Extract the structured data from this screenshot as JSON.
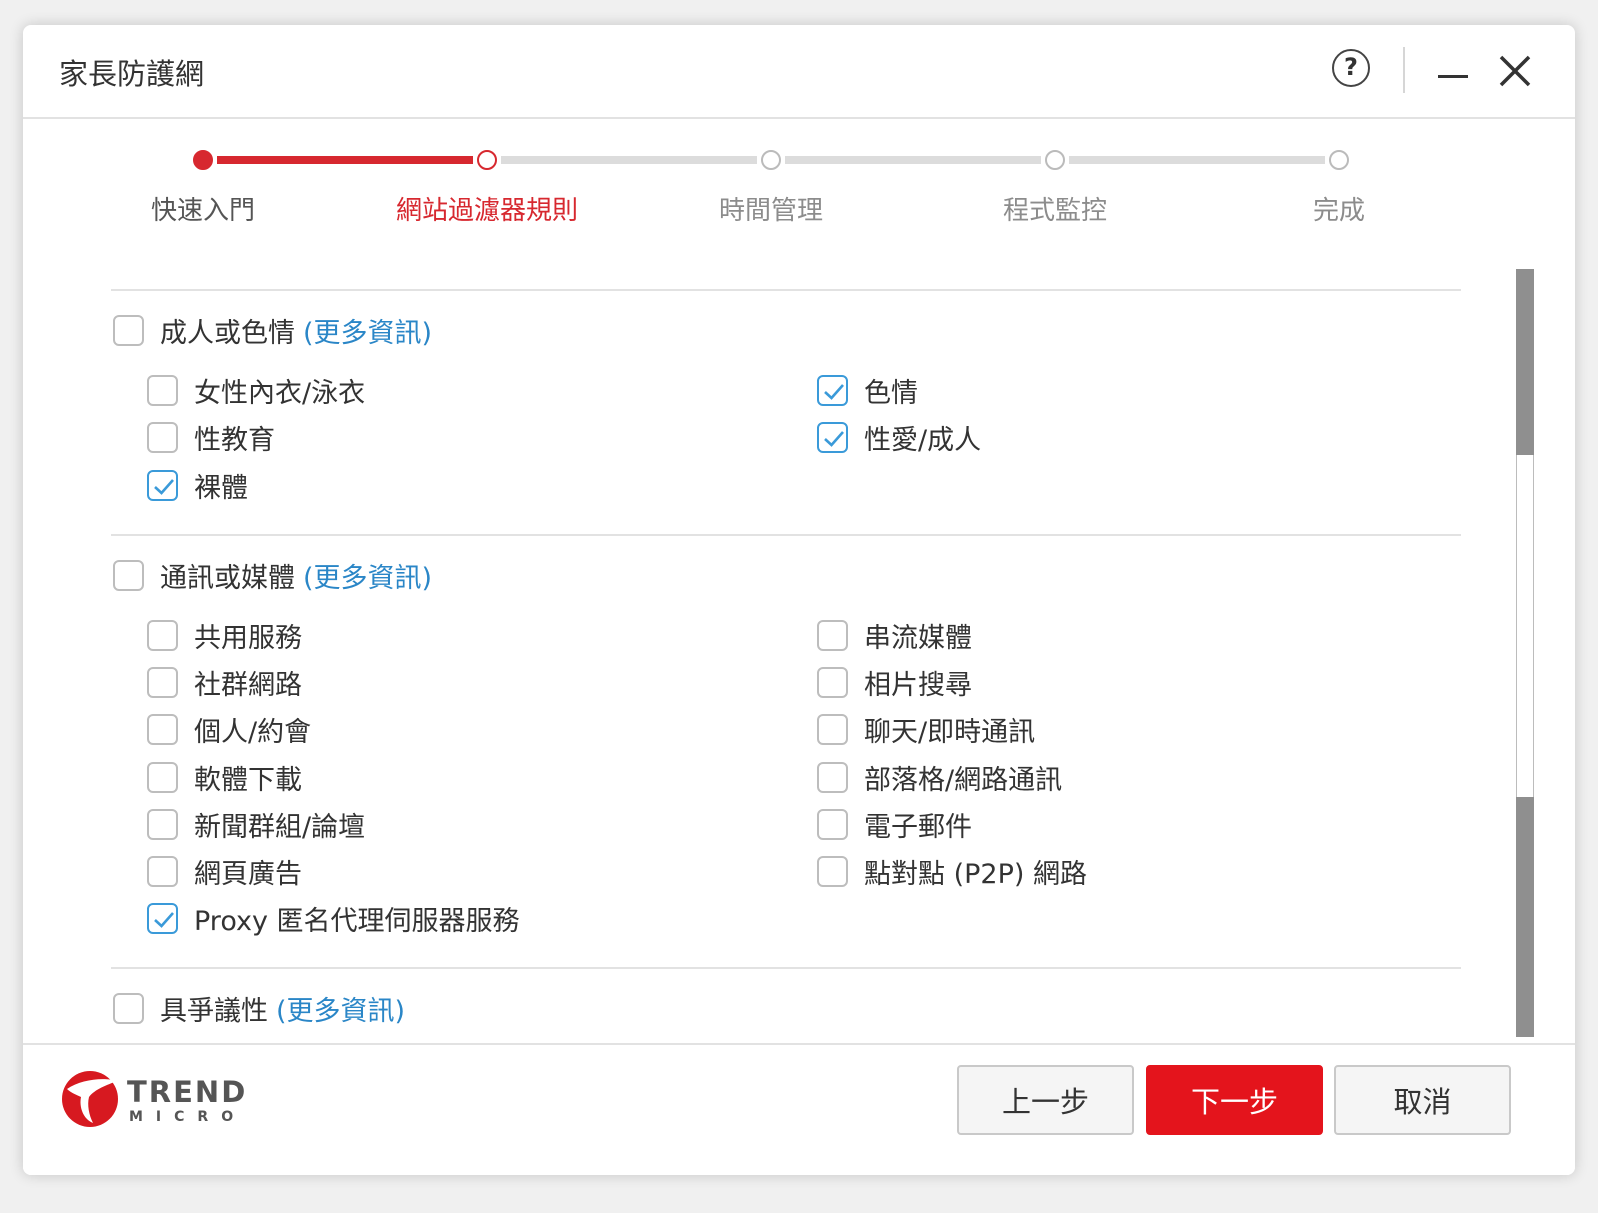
{
  "window": {
    "title": "家長防護網",
    "help_label": "?"
  },
  "steps": [
    {
      "label": "快速入門",
      "state": "done"
    },
    {
      "label": "網站過濾器規則",
      "state": "current"
    },
    {
      "label": "時間管理",
      "state": "pending"
    },
    {
      "label": "程式監控",
      "state": "pending"
    },
    {
      "label": "完成",
      "state": "pending"
    }
  ],
  "progress": {
    "completed_steps": 1,
    "total_steps": 5
  },
  "categories": [
    {
      "label": "成人或色情",
      "more_info": "(更多資訊)",
      "checked": false,
      "left_items": [
        {
          "label": "女性內衣/泳衣",
          "checked": false
        },
        {
          "label": "性教育",
          "checked": false
        },
        {
          "label": "裸體",
          "checked": true
        }
      ],
      "right_items": [
        {
          "label": "色情",
          "checked": true
        },
        {
          "label": "性愛/成人",
          "checked": true
        }
      ]
    },
    {
      "label": "通訊或媒體",
      "more_info": "(更多資訊)",
      "checked": false,
      "left_items": [
        {
          "label": "共用服務",
          "checked": false
        },
        {
          "label": "社群網路",
          "checked": false
        },
        {
          "label": "個人/約會",
          "checked": false
        },
        {
          "label": "軟體下載",
          "checked": false
        },
        {
          "label": "新聞群組/論壇",
          "checked": false
        },
        {
          "label": "網頁廣告",
          "checked": false
        },
        {
          "label": "Proxy 匿名代理伺服器服務",
          "checked": true
        }
      ],
      "right_items": [
        {
          "label": "串流媒體",
          "checked": false
        },
        {
          "label": "相片搜尋",
          "checked": false
        },
        {
          "label": "聊天/即時通訊",
          "checked": false
        },
        {
          "label": "部落格/網路通訊",
          "checked": false
        },
        {
          "label": "電子郵件",
          "checked": false
        },
        {
          "label": "點對點 (P2P) 網路",
          "checked": false
        }
      ]
    },
    {
      "label": "具爭議性",
      "more_info": "(更多資訊)",
      "checked": false,
      "left_items": [],
      "right_items": []
    }
  ],
  "footer": {
    "logo_word": "TREND",
    "logo_sub": "MICRO",
    "back_label": "上一步",
    "next_label": "下一步",
    "cancel_label": "取消"
  },
  "colors": {
    "accent_red": "#d7282f",
    "primary_button": "#e4141c",
    "checkbox_checked": "#3a9ad9",
    "link_blue": "#2a86c7"
  },
  "icons": {
    "help": "question-circle-icon",
    "minimize": "minimize-icon",
    "close": "close-icon",
    "check": "checkmark-icon",
    "logo": "trend-micro-logo"
  }
}
